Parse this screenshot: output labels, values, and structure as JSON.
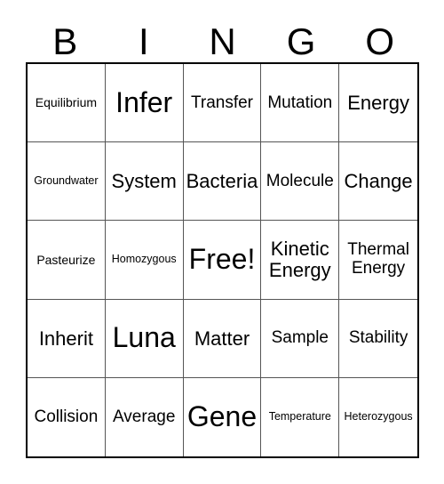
{
  "card": {
    "title": "BINGO card",
    "header_letters": [
      "B",
      "I",
      "N",
      "G",
      "O"
    ],
    "free_space_label": "Free!",
    "colors": {
      "background": "#ffffff",
      "text": "#000000",
      "outer_border": "#000000",
      "grid_line": "#555555"
    },
    "grid": {
      "rows": 5,
      "columns": 5,
      "cells": [
        {
          "text": "Equilibrium",
          "size": "fs-s"
        },
        {
          "text": "Infer",
          "size": "fs-xxl"
        },
        {
          "text": "Transfer",
          "size": "fs-m"
        },
        {
          "text": "Mutation",
          "size": "fs-m"
        },
        {
          "text": "Energy",
          "size": "fs-l"
        },
        {
          "text": "Groundwater",
          "size": "fs-xs"
        },
        {
          "text": "System",
          "size": "fs-l"
        },
        {
          "text": "Bacteria",
          "size": "fs-l"
        },
        {
          "text": "Molecule",
          "size": "fs-m"
        },
        {
          "text": "Change",
          "size": "fs-l"
        },
        {
          "text": "Pasteurize",
          "size": "fs-s"
        },
        {
          "text": "Homozygous",
          "size": "fs-xs"
        },
        {
          "text": "Free!",
          "size": "fs-xxl"
        },
        {
          "text": "Kinetic Energy",
          "size": "fs-l"
        },
        {
          "text": "Thermal Energy",
          "size": "fs-m"
        },
        {
          "text": "Inherit",
          "size": "fs-l"
        },
        {
          "text": "Luna",
          "size": "fs-xxl"
        },
        {
          "text": "Matter",
          "size": "fs-l"
        },
        {
          "text": "Sample",
          "size": "fs-m"
        },
        {
          "text": "Stability",
          "size": "fs-m"
        },
        {
          "text": "Collision",
          "size": "fs-m"
        },
        {
          "text": "Average",
          "size": "fs-m"
        },
        {
          "text": "Gene",
          "size": "fs-xxl"
        },
        {
          "text": "Temperature",
          "size": "fs-xs"
        },
        {
          "text": "Heterozygous",
          "size": "fs-xs"
        }
      ]
    }
  }
}
